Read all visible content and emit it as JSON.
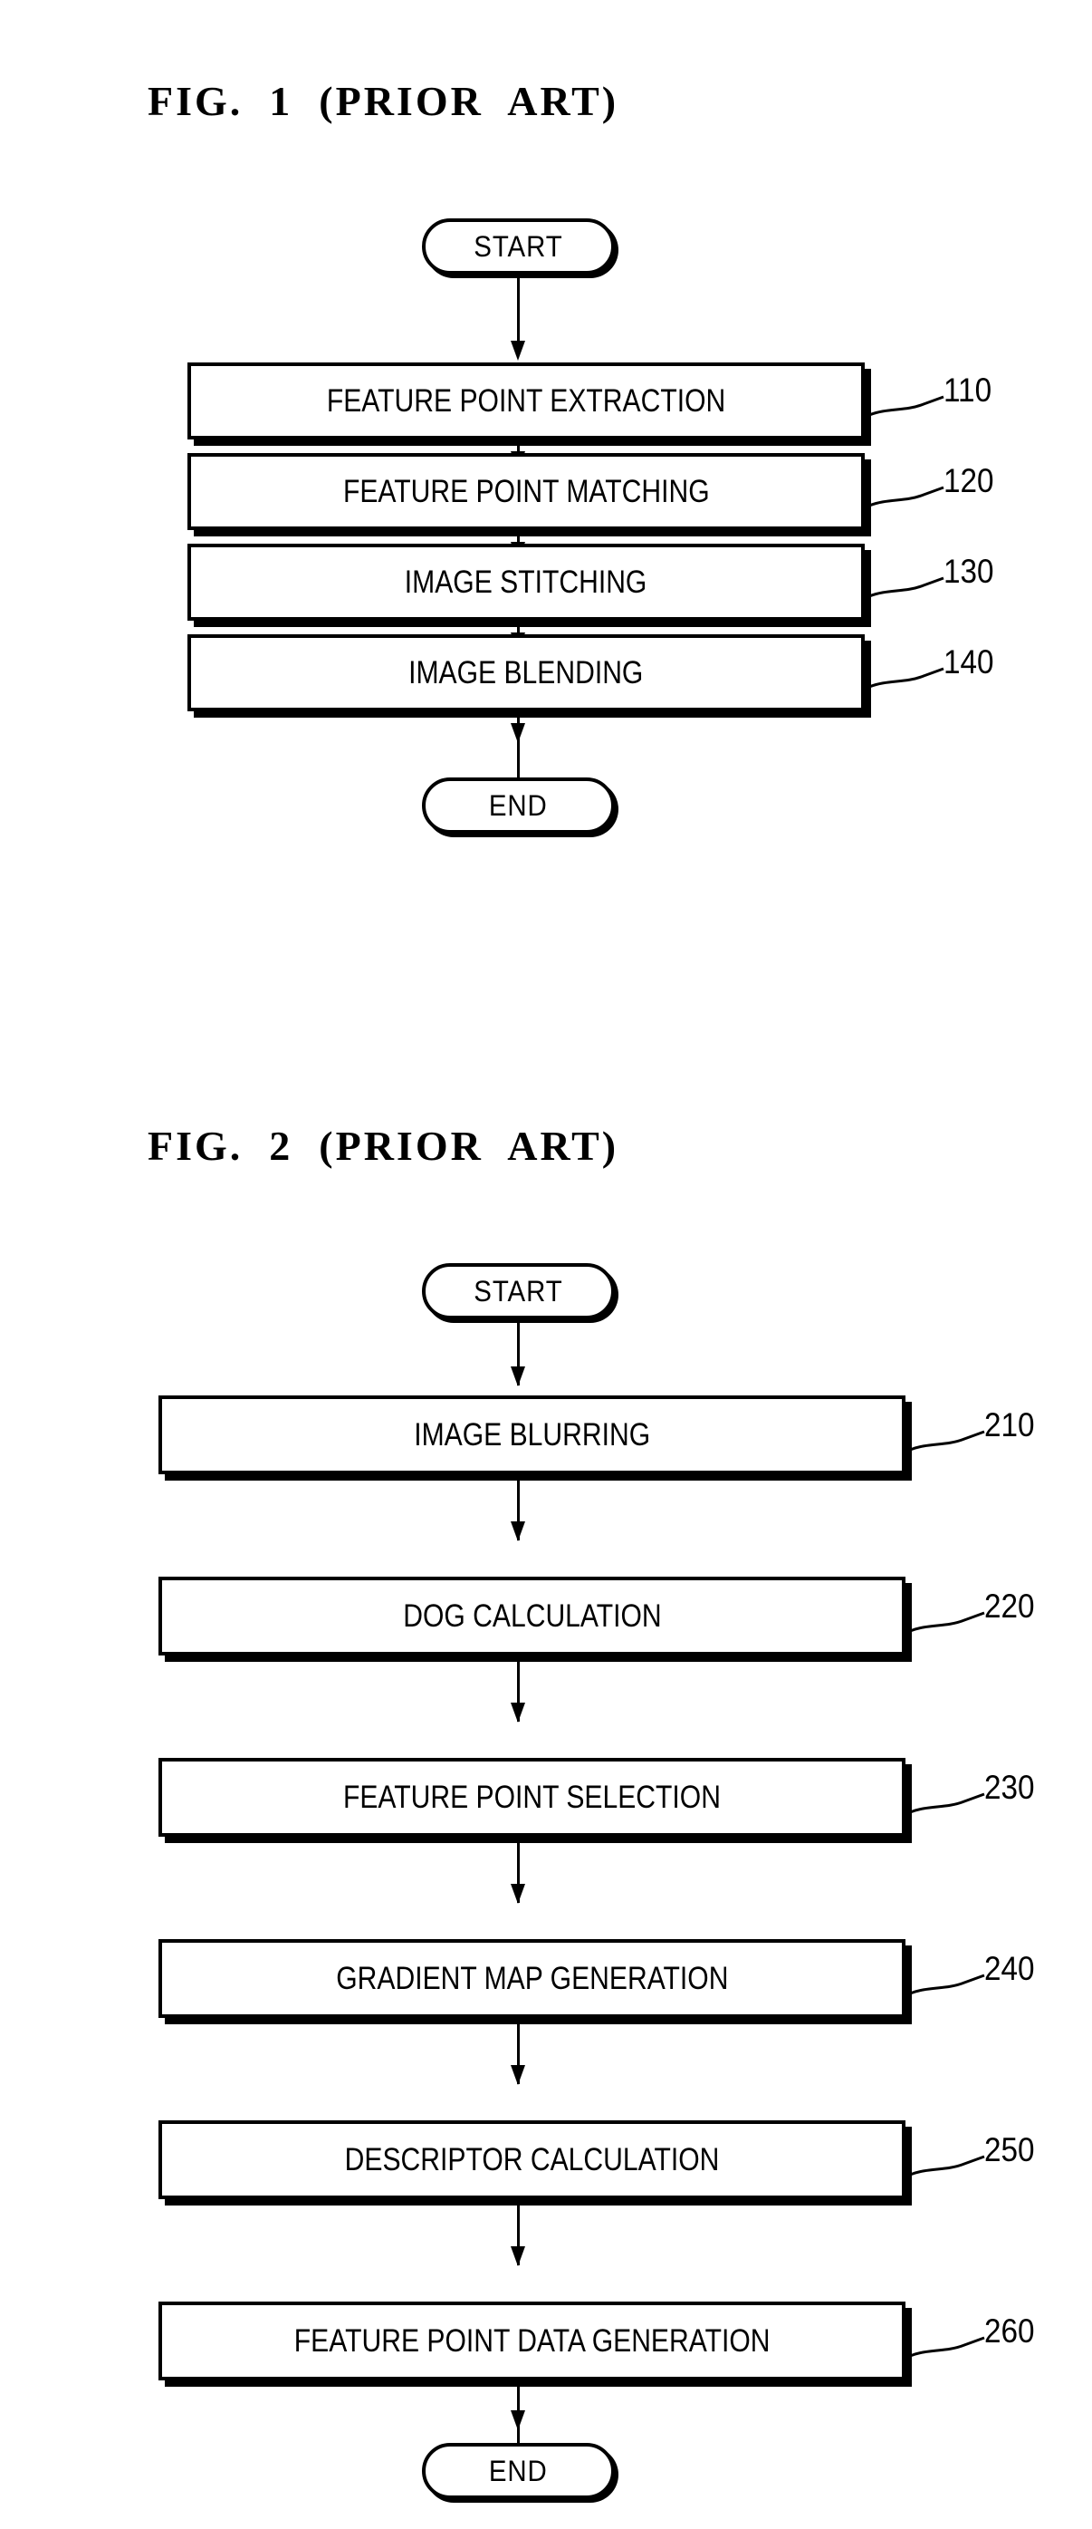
{
  "document": {
    "type": "patent-drawing-sheet",
    "background_color": "#ffffff",
    "ink_color": "#000000"
  },
  "figures": [
    {
      "id": "fig1",
      "caption": "FIG.  1  (PRIOR  ART)",
      "start_label": "START",
      "end_label": "END",
      "steps": [
        {
          "label": "FEATURE POINT EXTRACTION",
          "ref": "110"
        },
        {
          "label": "FEATURE POINT MATCHING",
          "ref": "120"
        },
        {
          "label": "IMAGE STITCHING",
          "ref": "130"
        },
        {
          "label": "IMAGE BLENDING",
          "ref": "140"
        }
      ]
    },
    {
      "id": "fig2",
      "caption": "FIG.  2  (PRIOR  ART)",
      "start_label": "START",
      "end_label": "END",
      "steps": [
        {
          "label": "IMAGE BLURRING",
          "ref": "210"
        },
        {
          "label": "DOG CALCULATION",
          "ref": "220"
        },
        {
          "label": "FEATURE POINT SELECTION",
          "ref": "230"
        },
        {
          "label": "GRADIENT MAP GENERATION",
          "ref": "240"
        },
        {
          "label": "DESCRIPTOR CALCULATION",
          "ref": "250"
        },
        {
          "label": "FEATURE POINT DATA GENERATION",
          "ref": "260"
        }
      ]
    }
  ]
}
